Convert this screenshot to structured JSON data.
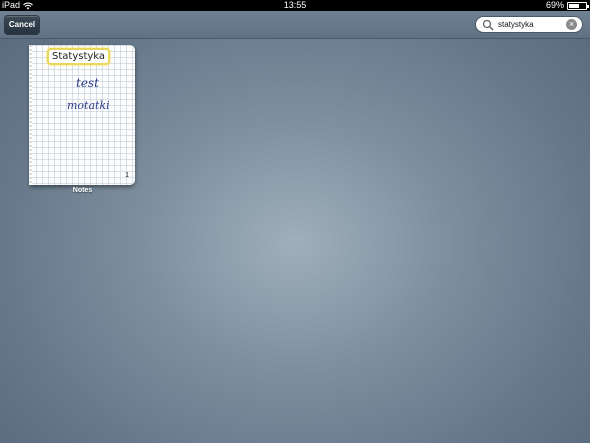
{
  "status_bar": {
    "device": "iPad",
    "time": "13:55",
    "battery_percent": "69%",
    "battery_level": 0.69
  },
  "toolbar": {
    "cancel_label": "Cancel"
  },
  "search": {
    "query": "statystyka"
  },
  "note": {
    "tag_text": "Statystyka",
    "lines": [
      "test",
      "motatki"
    ],
    "page_count": "1",
    "label": "Notes"
  }
}
